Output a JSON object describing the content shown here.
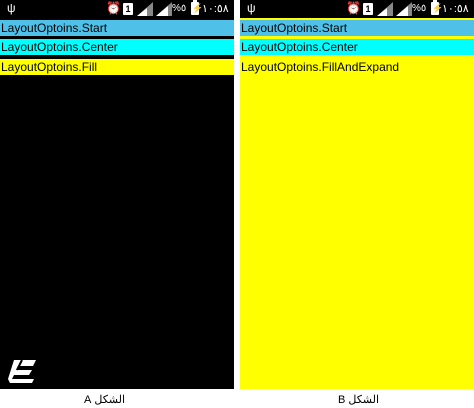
{
  "status_bar": {
    "clock": "١٠:٥٨",
    "battery_percent": "%٥",
    "sim_label": "1",
    "icons": [
      "usb-icon",
      "alarm-icon",
      "sim-icon",
      "signal-icon",
      "signal-icon",
      "battery-charging-icon"
    ]
  },
  "screen_a": {
    "rows": {
      "start": "LayoutOptoins.Start",
      "center": "LayoutOptoins.Center",
      "fill": "LayoutOptoins.Fill"
    },
    "caption": "الشكل A"
  },
  "screen_b": {
    "rows": {
      "start": "LayoutOptoins.Start",
      "center": "LayoutOptoins.Center",
      "fill": "LayoutOptoins.FillAndExpand"
    },
    "caption": "الشكل B"
  },
  "colors": {
    "start_row": "#4fc1e9",
    "center_row": "#00ffff",
    "fill_row": "#ffff00",
    "screen_a_bg": "#000000",
    "screen_b_bg": "#ffff00"
  }
}
